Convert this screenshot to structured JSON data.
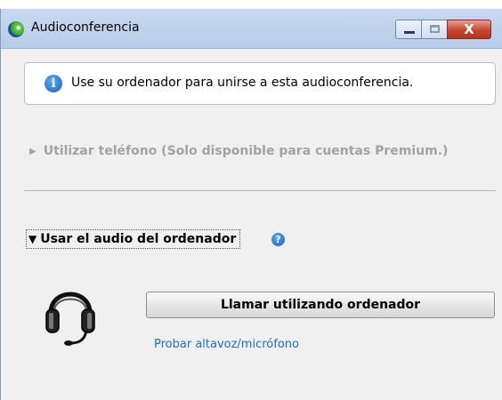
{
  "window": {
    "title": "Audioconferencia",
    "app_icon": "globe-icon",
    "buttons": {
      "minimize": "minimize-icon",
      "maximize": "maximize-icon",
      "close_label": "X"
    }
  },
  "info": {
    "icon": "info-icon",
    "icon_glyph": "i",
    "text": "Use su ordenador para unirse a esta audioconferencia."
  },
  "phone_section": {
    "label": "Utilizar teléfono (Solo disponible para cuentas Premium.)",
    "expanded": false,
    "enabled": false
  },
  "computer_audio": {
    "label": "Usar el audio del ordenador",
    "expanded": true,
    "help_glyph": "?",
    "icon": "headset-icon",
    "call_button": "Llamar utilizando ordenador",
    "test_link": "Probar altavoz/micrófono"
  },
  "colors": {
    "link": "#1f6fbf",
    "disabled_text": "#a3a3a3",
    "close_button": "#c8452e",
    "info_icon": "#1f64c4"
  }
}
